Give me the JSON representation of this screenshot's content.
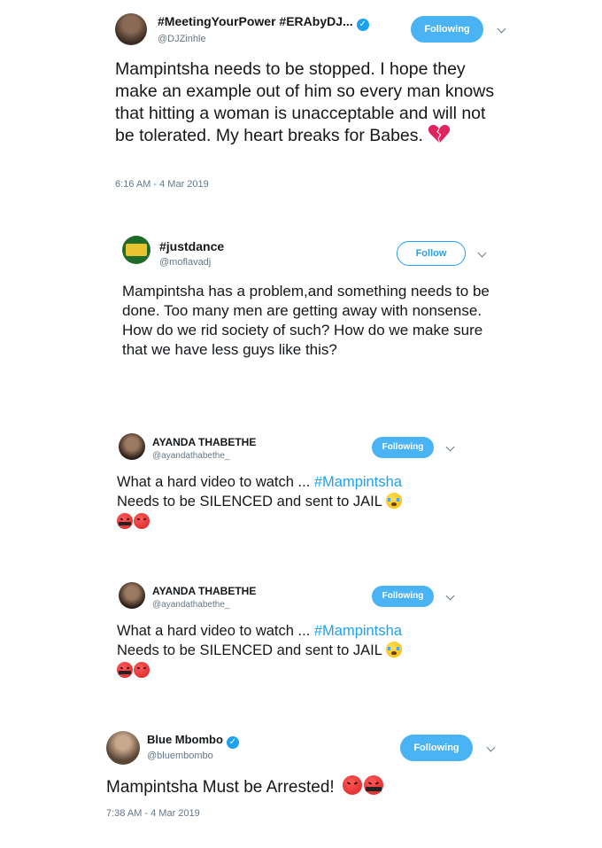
{
  "tweets": [
    {
      "name": "#MeetingYourPower #ERAbyDJ...",
      "handle": "@DJZinhle",
      "verified": true,
      "button": "Following",
      "text": "Mampintsha needs to be stopped. I hope they make an example out of him so every man knows that hitting a woman is unacceptable and will not be tolerated.   My heart breaks for Babes.",
      "trailing_emoji": "broken-heart-icon",
      "timestamp": "6:16 AM - 4 Mar 2019"
    },
    {
      "name": "#justdance",
      "handle": "@moflavadj",
      "verified": false,
      "button": "Follow",
      "text": "Mampintsha has a problem,and something needs to be done. Too many men are getting away with nonsense. How do we rid society of such? How do we make sure that we have less guys like this?"
    },
    {
      "name": "AYANDA THABETHE",
      "handle": "@ayandathabethe_",
      "verified": false,
      "button": "Following",
      "text_line1_prefix": "What a hard video to watch  ... ",
      "hashtag": "#Mampintsha",
      "text_line2": "Needs to be SILENCED and sent to JAIL",
      "emojis": [
        "crying-face-icon",
        "cursing-face-icon",
        "angry-face-icon"
      ]
    },
    {
      "name": "AYANDA THABETHE",
      "handle": "@ayandathabethe_",
      "verified": false,
      "button": "Following",
      "text_line1_prefix": "What a hard video to watch  ... ",
      "hashtag": "#Mampintsha",
      "text_line2": "Needs to be SILENCED and sent to JAIL",
      "emojis": [
        "crying-face-icon",
        "cursing-face-icon",
        "angry-face-icon"
      ]
    },
    {
      "name": "Blue Mbombo",
      "handle": "@bluembombo",
      "verified": true,
      "button": "Following",
      "text": "Mampintsha Must be Arrested!",
      "emojis": [
        "angry-face-icon",
        "cursing-face-icon"
      ],
      "timestamp": "7:38 AM - 4 Mar 2019"
    }
  ],
  "colors": {
    "following_bg": "#4ab3f4",
    "follow_border": "#1da1f2",
    "hashtag": "#1da1f2",
    "muted": "#657786"
  }
}
